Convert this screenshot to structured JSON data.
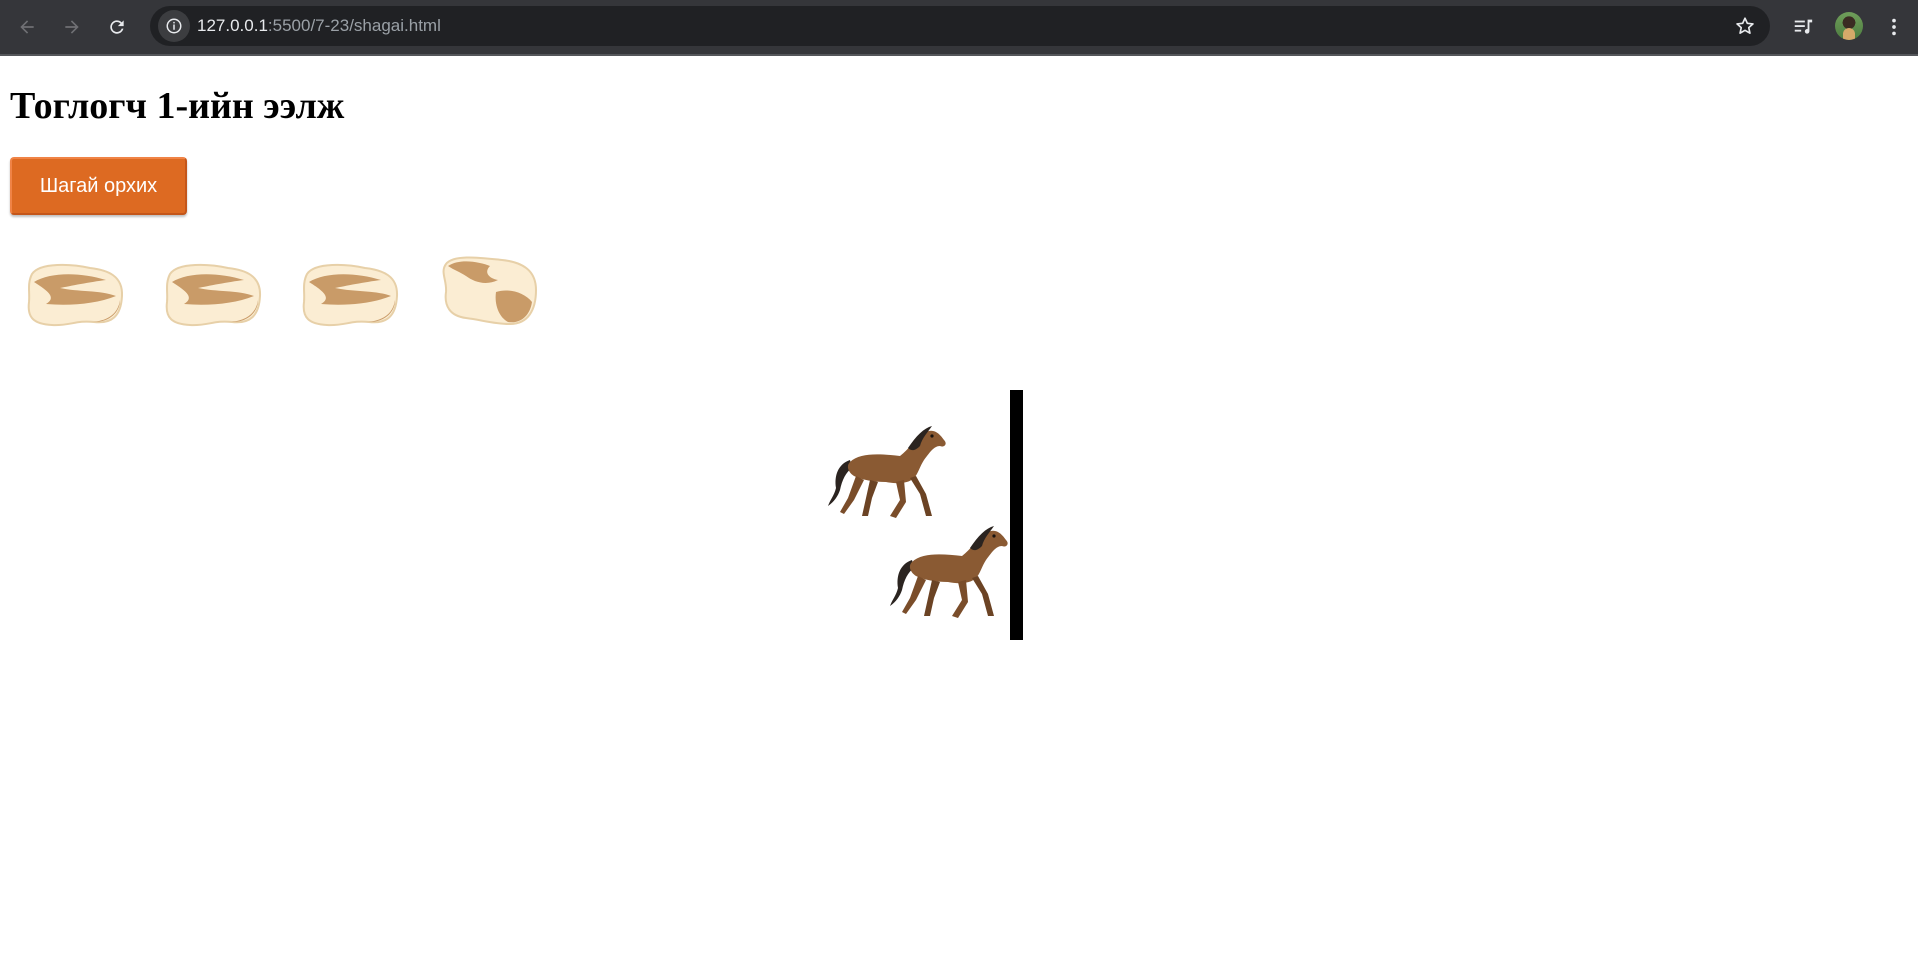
{
  "browser": {
    "url_host": "127.0.0.1",
    "url_path": ":5500/7-23/shagai.html"
  },
  "game": {
    "turn_text": "Тоглогч 1-ийн ээлж",
    "roll_button_label": "Шагай орхих",
    "shagai_count": 4,
    "shagai_sides": [
      "horse",
      "horse",
      "horse",
      "sheep"
    ],
    "players": [
      {
        "piece": "horse-icon"
      },
      {
        "piece": "horse-icon"
      }
    ]
  },
  "colors": {
    "button": "#dd6a22",
    "shagai_base": "#fbedd3",
    "shagai_mark": "#c99b68",
    "horse_body": "#8a5a33",
    "finish_line": "#000000"
  }
}
